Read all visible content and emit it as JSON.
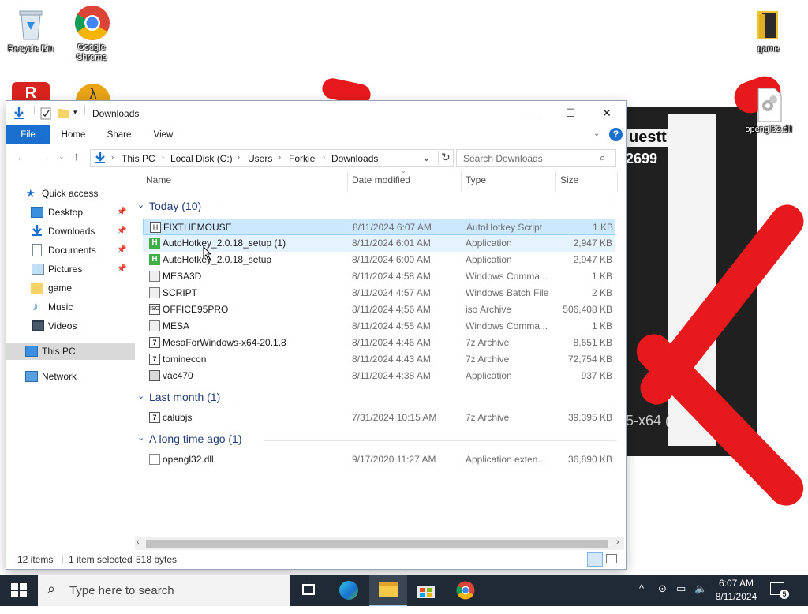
{
  "desktop": {
    "icons": [
      {
        "label": "Recycle Bin"
      },
      {
        "label": "Google Chrome"
      },
      {
        "label": "game"
      },
      {
        "label": "opengl32.dll"
      }
    ],
    "bg_text_top": "uestt",
    "bg_text_num": "2699",
    "bg_text_bottom": "5-x64 ("
  },
  "window": {
    "title": "Downloads",
    "controls": {
      "minimize": "—",
      "maximize": "☐",
      "close": "✕"
    },
    "ribbon_tabs": [
      "File",
      "Home",
      "Share",
      "View"
    ],
    "address": {
      "crumbs": [
        "This PC",
        "Local Disk (C:)",
        "Users",
        "Forkie",
        "Downloads"
      ]
    },
    "search_placeholder": "Search Downloads",
    "nav": [
      {
        "label": "Quick access",
        "icon": "star-icon"
      },
      {
        "label": "Desktop",
        "icon": "desktop-icon",
        "pinned": true
      },
      {
        "label": "Downloads",
        "icon": "download-arrow-icon",
        "pinned": true
      },
      {
        "label": "Documents",
        "icon": "document-icon",
        "pinned": true
      },
      {
        "label": "Pictures",
        "icon": "picture-icon",
        "pinned": true
      },
      {
        "label": "game",
        "icon": "folder-icon"
      },
      {
        "label": "Music",
        "icon": "music-note-icon"
      },
      {
        "label": "Videos",
        "icon": "video-icon"
      },
      {
        "label": "This PC",
        "icon": "computer-icon"
      },
      {
        "label": "Network",
        "icon": "network-icon"
      }
    ],
    "columns": [
      "Name",
      "Date modified",
      "Type",
      "Size"
    ],
    "groups": [
      {
        "title": "Today (10)",
        "files": [
          {
            "name": "FIXTHEMOUSE",
            "date": "8/11/2024 6:07 AM",
            "type": "AutoHotkey Script",
            "size": "1 KB",
            "icon": "ahk-script-icon"
          },
          {
            "name": "AutoHotkey_2.0.18_setup (1)",
            "date": "8/11/2024 6:01 AM",
            "type": "Application",
            "size": "2,947 KB",
            "icon": "ahk-app-icon"
          },
          {
            "name": "AutoHotkey_2.0.18_setup",
            "date": "8/11/2024 6:00 AM",
            "type": "Application",
            "size": "2,947 KB",
            "icon": "ahk-app-icon"
          },
          {
            "name": "MESA3D",
            "date": "8/11/2024 4:58 AM",
            "type": "Windows Comma...",
            "size": "1 KB",
            "icon": "cmd-file-icon"
          },
          {
            "name": "SCRIPT",
            "date": "8/11/2024 4:57 AM",
            "type": "Windows Batch File",
            "size": "2 KB",
            "icon": "batch-file-icon"
          },
          {
            "name": "OFFICE95PRO",
            "date": "8/11/2024 4:56 AM",
            "type": "iso Archive",
            "size": "506,408 KB",
            "icon": "iso-archive-icon"
          },
          {
            "name": "MESA",
            "date": "8/11/2024 4:55 AM",
            "type": "Windows Comma...",
            "size": "1 KB",
            "icon": "cmd-file-icon"
          },
          {
            "name": "MesaForWindows-x64-20.1.8",
            "date": "8/11/2024 4:46 AM",
            "type": "7z Archive",
            "size": "8,651 KB",
            "icon": "7z-archive-icon"
          },
          {
            "name": "tominecon",
            "date": "8/11/2024 4:43 AM",
            "type": "7z Archive",
            "size": "72,754 KB",
            "icon": "7z-archive-icon"
          },
          {
            "name": "vac470",
            "date": "8/11/2024 4:38 AM",
            "type": "Application",
            "size": "937 KB",
            "icon": "app-icon"
          }
        ]
      },
      {
        "title": "Last month (1)",
        "files": [
          {
            "name": "calubjs",
            "date": "7/31/2024 10:15 AM",
            "type": "7z Archive",
            "size": "39,395 KB",
            "icon": "7z-archive-icon"
          }
        ]
      },
      {
        "title": "A long time ago (1)",
        "files": [
          {
            "name": "opengl32.dll",
            "date": "9/17/2020 11:27 AM",
            "type": "Application exten...",
            "size": "36,890 KB",
            "icon": "dll-file-icon"
          }
        ]
      }
    ],
    "status": {
      "count": "12 items",
      "selected": "1 item selected",
      "bytes": "518 bytes"
    }
  },
  "taskbar": {
    "search_placeholder": "Type here to search",
    "time": "6:07 AM",
    "date": "8/11/2024",
    "notifications": "5"
  },
  "colors": {
    "accent": "#1a6fcf",
    "selection": "#cce8ff",
    "group_title": "#1e3b78",
    "taskbar": "#1f2a36",
    "scribble": "#e8191c"
  }
}
